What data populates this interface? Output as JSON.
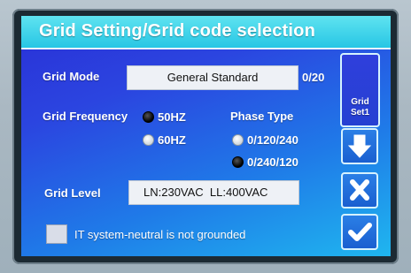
{
  "window": {
    "title": "Grid Setting/Grid code selection"
  },
  "grid_mode": {
    "label": "Grid Mode",
    "value": "General Standard",
    "count": "0/20"
  },
  "grid_frequency": {
    "label": "Grid Frequency",
    "options": [
      {
        "label": "50HZ",
        "selected": true
      },
      {
        "label": "60HZ",
        "selected": false
      }
    ]
  },
  "phase_type": {
    "label": "Phase Type",
    "options": [
      {
        "label": "0/120/240",
        "selected": false
      },
      {
        "label": "0/240/120",
        "selected": true
      }
    ]
  },
  "grid_level": {
    "label": "Grid Level",
    "value": "LN:230VAC  LL:400VAC"
  },
  "it_system": {
    "label": "IT system-neutral is not grounded",
    "checked": false
  },
  "side_panel": {
    "set_button_label": "Grid\nSet1",
    "down_icon": "arrow-down-icon",
    "cancel_icon": "x-icon",
    "confirm_icon": "check-icon"
  },
  "colors": {
    "title_bar": "#27c6e4",
    "screen_gradient_start": "#2a2fd6",
    "screen_gradient_end": "#1fb6ef"
  }
}
